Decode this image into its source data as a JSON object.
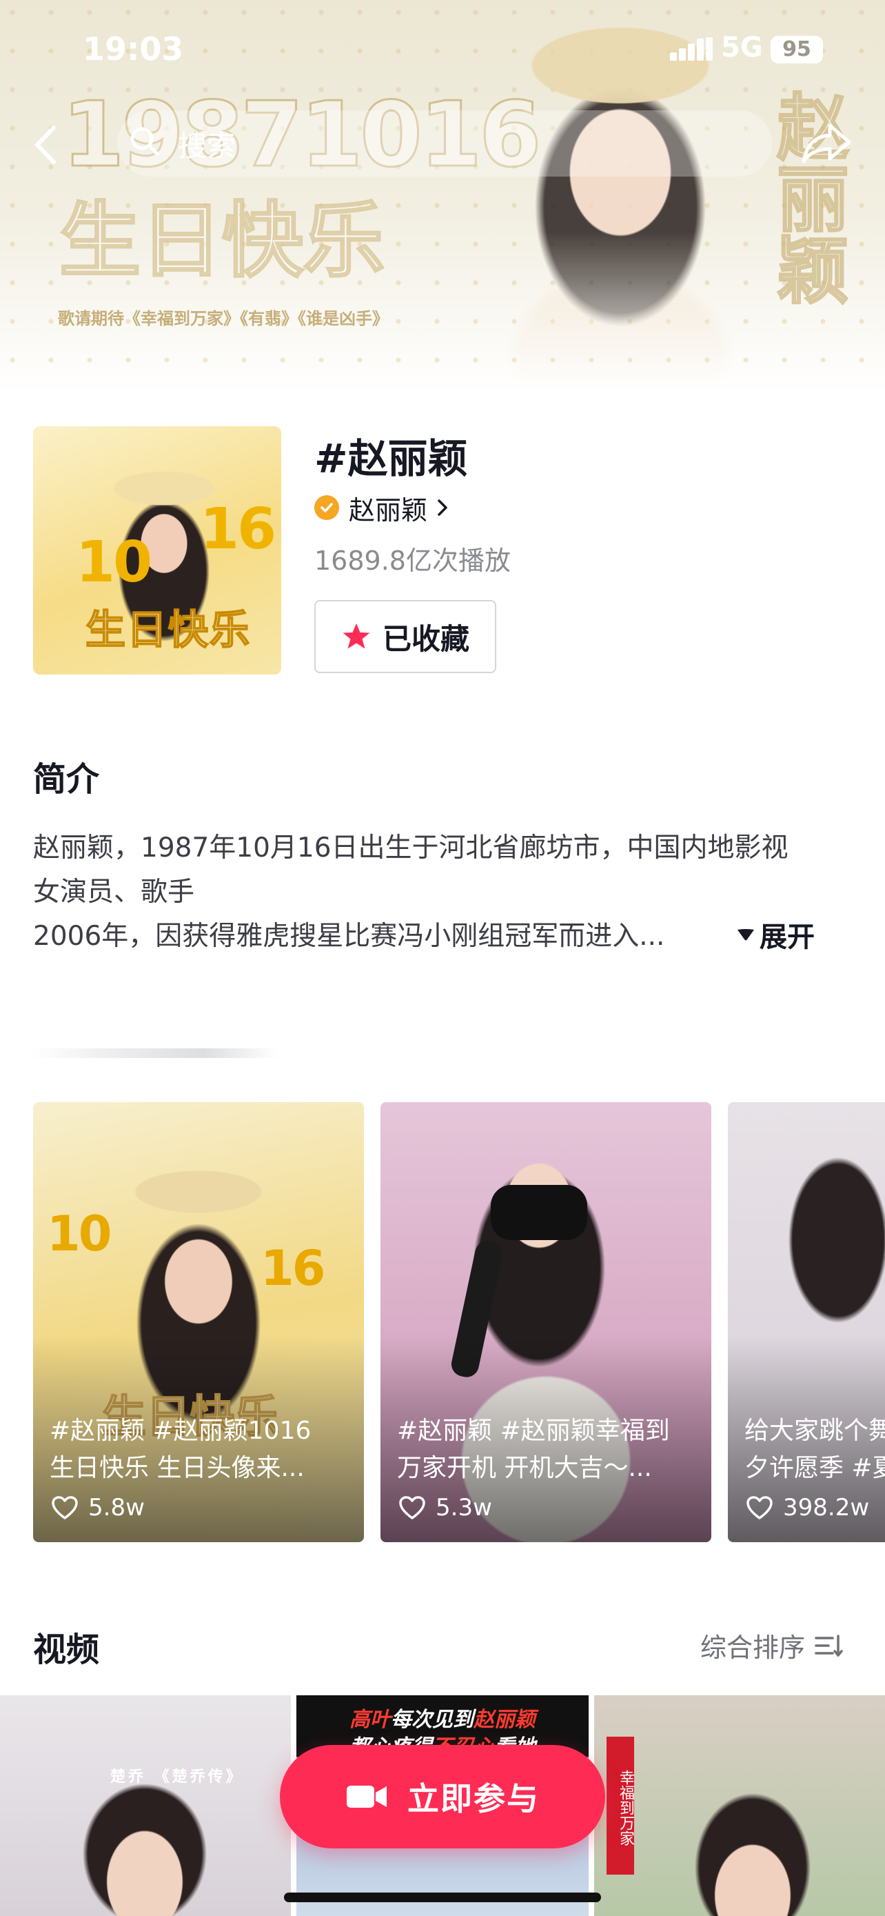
{
  "status_bar": {
    "time": "19:03",
    "network": "5G",
    "battery": "95"
  },
  "hero": {
    "big_number": "19871016",
    "birthday_text": "生日快乐",
    "songs_line": "歌请期待《幸福到万家》《有翡》《谁是凶手》",
    "vertical_name": "赵丽颖",
    "search_placeholder": "搜索"
  },
  "topic": {
    "title": "#赵丽颖",
    "creator": "赵丽颖",
    "plays": "1689.8亿次播放",
    "favorite_label": "已收藏",
    "cover_num_left": "10",
    "cover_num_right": "16",
    "cover_birthday": "生日快乐"
  },
  "intro": {
    "heading": "简介",
    "lines": [
      "赵丽颖，1987年10月16日出生于河北省廊坊市，中国内地影视",
      "女演员、歌手",
      "2006年，因获得雅虎搜星比赛冯小刚组冠军而进入..."
    ],
    "expand_label": "展开"
  },
  "hot_cards": [
    {
      "line1": "#赵丽颖 #赵丽颖1016",
      "line2": "生日快乐 生日头像来...",
      "likes": "5.8w"
    },
    {
      "line1": "#赵丽颖 #赵丽颖幸福到",
      "line2": "万家开机 开机大吉～...",
      "likes": "5.3w"
    },
    {
      "line1": "给大家跳个舞",
      "line2": "夕许愿季 #夏",
      "likes": "398.2w"
    }
  ],
  "videos": {
    "heading": "视频",
    "sort_label": "综合排序",
    "thumb1_caption": "楚乔 《楚乔传》",
    "thumb2_line1_a": "高叶",
    "thumb2_line1_b": "每次见到",
    "thumb2_line1_c": "赵丽颖",
    "thumb2_line2_a": "都心疼得",
    "thumb2_line2_b": "不忍心",
    "thumb2_line2_c": "看她",
    "thumb3_badge": "幸福到万家"
  },
  "cta": {
    "label": "立即参与"
  },
  "colors": {
    "accent": "#fe2c55",
    "verified": "#f5a623",
    "text_primary": "#161823",
    "text_secondary": "#8a8b91"
  }
}
